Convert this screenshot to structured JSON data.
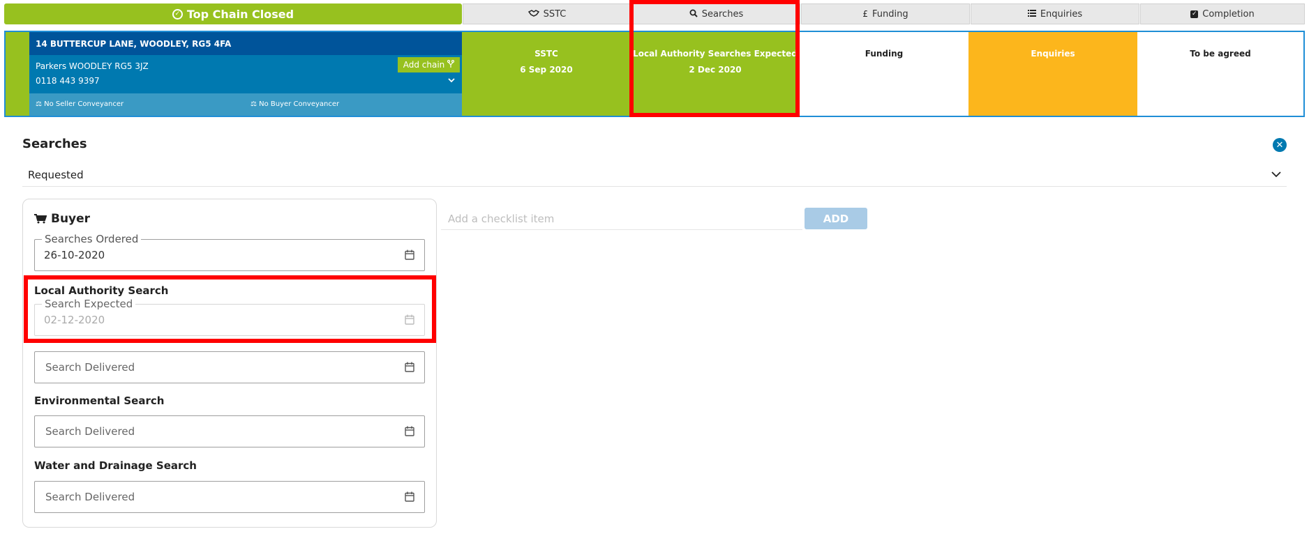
{
  "tabs": {
    "main": "Top Chain Closed",
    "sstc": "SSTC",
    "searches": "Searches",
    "funding": "Funding",
    "enquiries": "Enquiries",
    "completion": "Completion"
  },
  "chain": {
    "address": "14 BUTTERCUP LANE, WOODLEY, RG5 4FA",
    "agent": "Parkers WOODLEY RG5 3JZ",
    "phone": "0118 443 9397",
    "add_chain_label": "Add chain",
    "seller_conveyancer": "No Seller Conveyancer",
    "buyer_conveyancer": "No Buyer Conveyancer",
    "stages": {
      "sstc_title": "SSTC",
      "sstc_date": "6 Sep 2020",
      "searches_title": "Local Authority Searches Expected",
      "searches_date": "2 Dec 2020",
      "funding_title": "Funding",
      "enquiries_title": "Enquiries",
      "completion_title": "To be agreed"
    }
  },
  "panel": {
    "title": "Searches",
    "status": "Requested",
    "buyer_heading": "Buyer",
    "searches_ordered_label": "Searches Ordered",
    "searches_ordered_value": "26-10-2020",
    "local_authority_heading": "Local Authority Search",
    "search_expected_label": "Search Expected",
    "search_expected_value": "02-12-2020",
    "local_delivered_placeholder": "Search Delivered",
    "environmental_heading": "Environmental Search",
    "environmental_delivered_placeholder": "Search Delivered",
    "water_heading": "Water and Drainage Search",
    "water_delivered_placeholder": "Search Delivered"
  },
  "checklist": {
    "placeholder": "Add a checklist item",
    "add_label": "ADD"
  },
  "colors": {
    "green": "#97c11f",
    "blue_dark": "#00549a",
    "blue": "#0079b0",
    "orange": "#fcb61c",
    "highlight": "#ff0000"
  }
}
